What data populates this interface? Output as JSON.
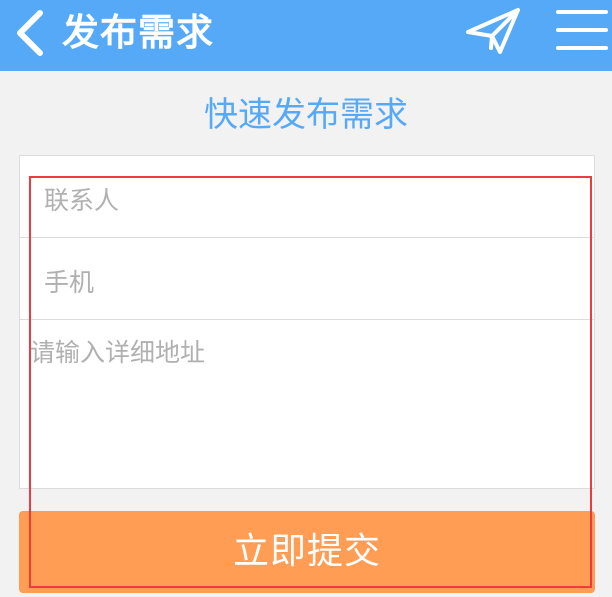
{
  "header": {
    "title": "发布需求",
    "back_icon": "chevron-left-icon",
    "send_icon": "paper-plane-icon",
    "menu_icon": "hamburger-menu-icon",
    "background_color": "#55a9f7"
  },
  "main": {
    "heading": "快速发布需求",
    "heading_color": "#55a9f7"
  },
  "form": {
    "contact_placeholder": "联系人",
    "contact_value": "",
    "phone_placeholder": "手机",
    "phone_value": "",
    "address_placeholder": "请输入详细地址",
    "address_value": ""
  },
  "actions": {
    "submit_label": "立即提交",
    "submit_color": "#ff9d55"
  },
  "annotation": {
    "highlight_color": "#ee3b3b"
  }
}
